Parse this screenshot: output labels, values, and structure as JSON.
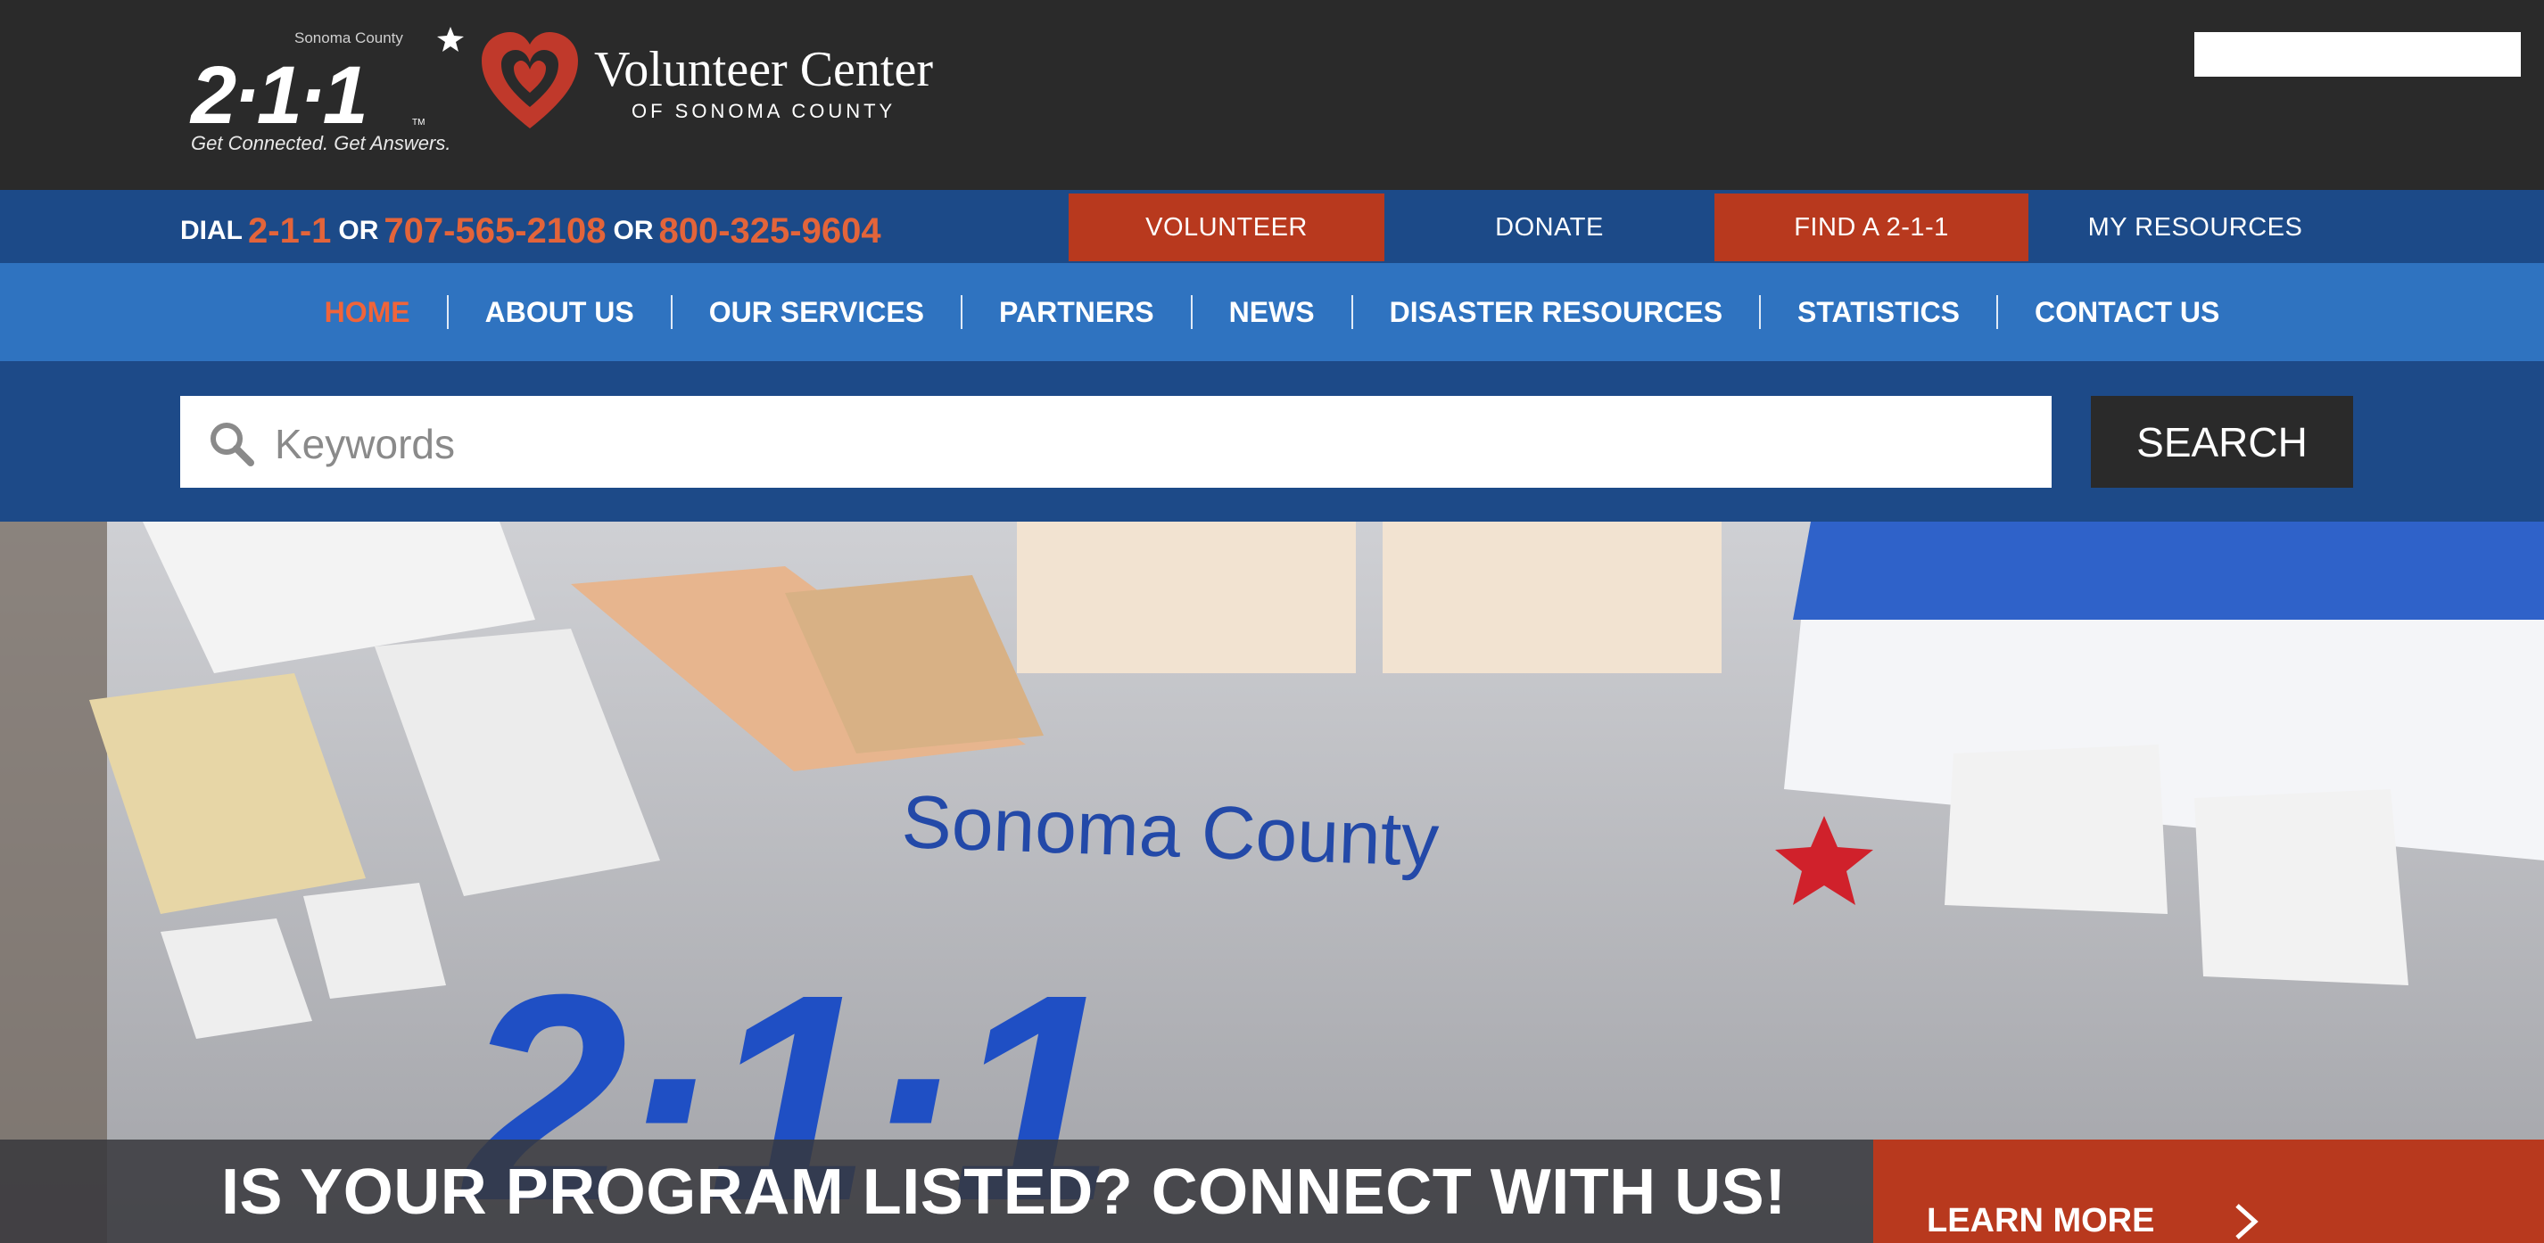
{
  "header": {
    "logo_211": {
      "county": "Sonoma County",
      "mark": "2·1·1",
      "tagline": "Get Connected. Get Answers.",
      "tm": "TM"
    },
    "volunteer_center": {
      "name": "Volunteer Center",
      "sub": "OF SONOMA COUNTY"
    },
    "search_placeholder": ""
  },
  "topbar": {
    "dial_prefix": "DIAL",
    "numbers": [
      "2-1-1",
      "707-565-2108",
      "800-325-9604"
    ],
    "or": "OR",
    "buttons": {
      "volunteer": "VOLUNTEER",
      "donate": "DONATE",
      "find": "FIND A 2-1-1",
      "resources": "MY RESOURCES"
    }
  },
  "nav": {
    "items": [
      "HOME",
      "ABOUT US",
      "OUR SERVICES",
      "PARTNERS",
      "NEWS",
      "DISASTER RESOURCES",
      "STATISTICS",
      "CONTACT US"
    ],
    "active": "HOME"
  },
  "search": {
    "placeholder": "Keywords",
    "button": "SEARCH"
  },
  "hero": {
    "tablecloth_county": "Sonoma County",
    "tablecloth_mark": "2·1·1",
    "banner_text": "IS YOUR PROGRAM LISTED? CONNECT WITH US!",
    "learn_more": "LEARN MORE"
  },
  "colors": {
    "header_bg": "#2a2a2a",
    "topbar_bg": "#1c4a88",
    "nav_bg": "#2f73c0",
    "accent_red": "#b8391e",
    "accent_orange": "#e3643a"
  }
}
